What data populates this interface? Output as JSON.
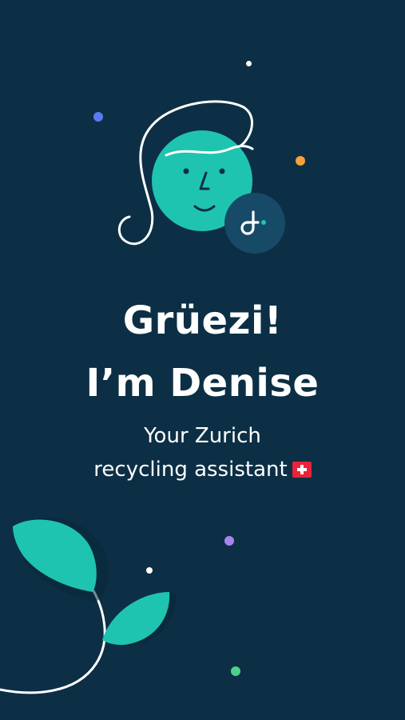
{
  "headline": {
    "line1": "Grüezi!",
    "line2": "I’m Denise"
  },
  "subtitle": {
    "line1": "Your Zurich",
    "line2": "recycling assistant"
  },
  "icons": {
    "avatar": "denise-face-illustration",
    "logo": "d-logo-icon",
    "flag": "swiss-flag-icon",
    "plant": "sprout-illustration"
  },
  "colors": {
    "background": "#0c2f45",
    "accent": "#1fc4b0",
    "badge": "#174a67",
    "text": "#ffffff"
  }
}
